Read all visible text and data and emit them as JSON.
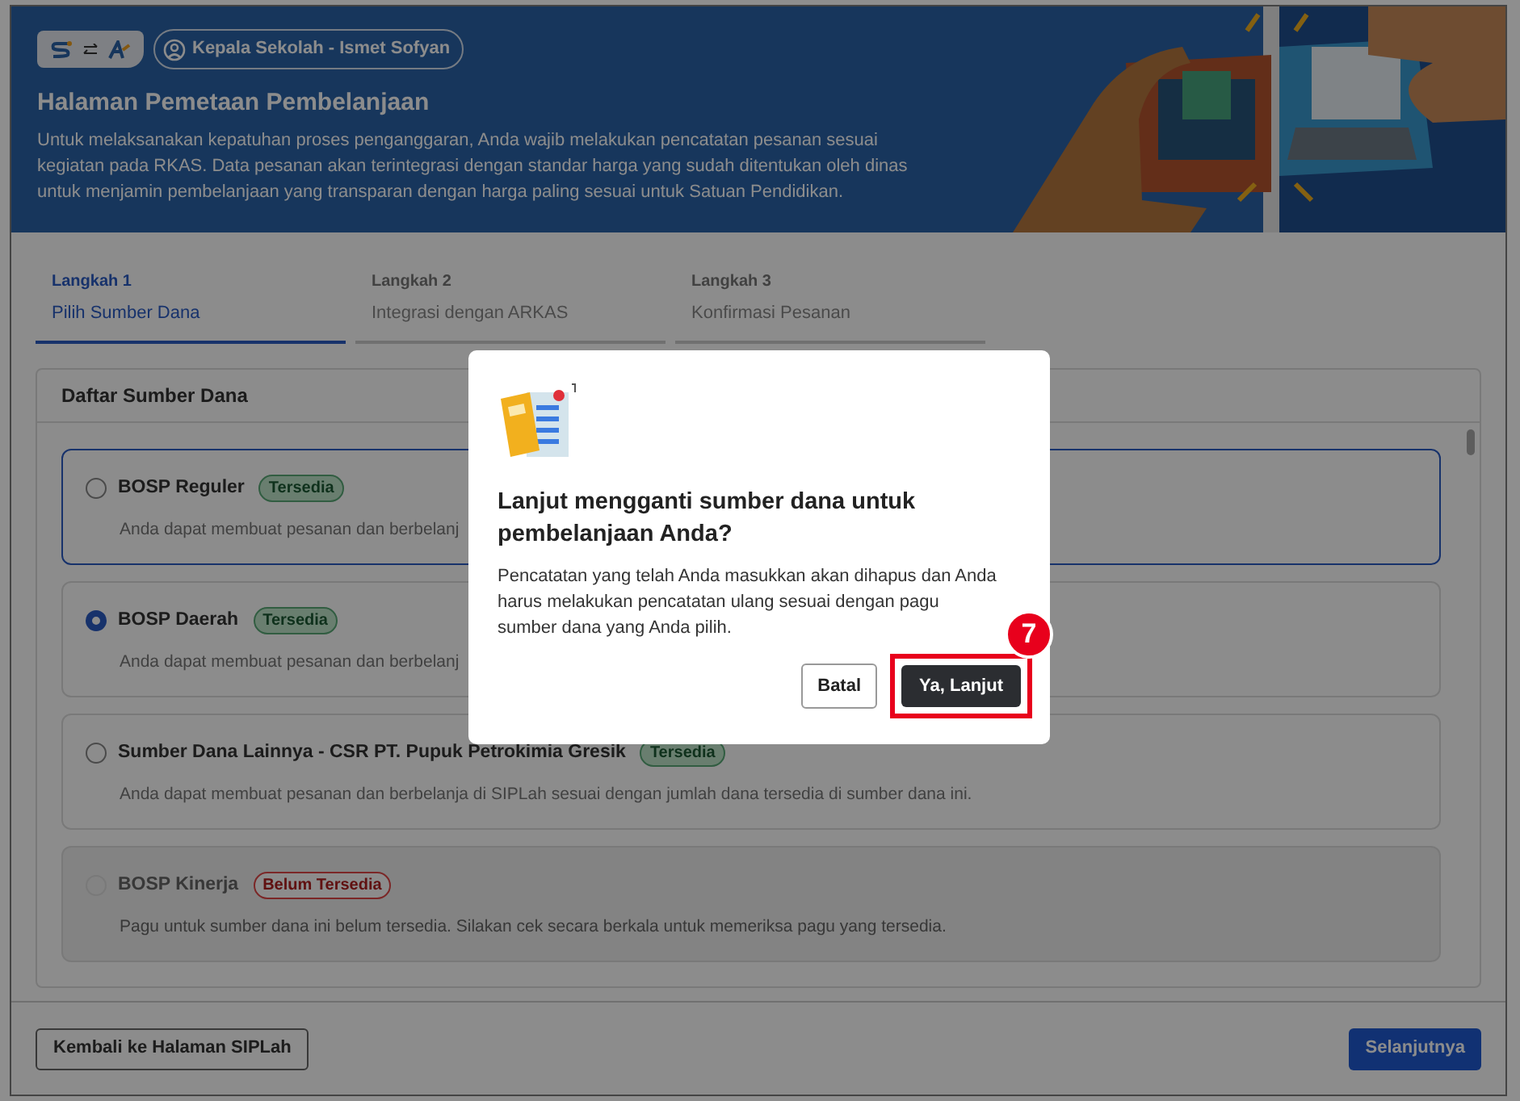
{
  "header": {
    "role_chip": "Kepala Sekolah - Ismet Sofyan",
    "title": "Halaman Pemetaan Pembelanjaan",
    "description": "Untuk melaksanakan kepatuhan proses penganggaran, Anda wajib melakukan pencatatan pesanan sesuai kegiatan pada RKAS. Data pesanan akan terintegrasi dengan standar harga yang sudah ditentukan oleh dinas untuk menjamin pembelanjaan yang transparan dengan harga paling sesuai untuk Satuan Pendidikan."
  },
  "steps": [
    {
      "step": "Langkah 1",
      "label": "Pilih Sumber Dana",
      "selected": true
    },
    {
      "step": "Langkah 2",
      "label": "Integrasi dengan ARKAS",
      "selected": false
    },
    {
      "step": "Langkah 3",
      "label": "Konfirmasi Pesanan",
      "selected": false
    }
  ],
  "fund_list": {
    "title": "Daftar Sumber Dana",
    "options": [
      {
        "name": "BOSP Reguler",
        "badge": "Tersedia",
        "kind": "available",
        "description": "Anda dapat membuat pesanan dan berbelanj",
        "selected": false,
        "focused": true,
        "disabled": false
      },
      {
        "name": "BOSP Daerah",
        "badge": "Tersedia",
        "kind": "available",
        "description": "Anda dapat membuat pesanan dan berbelanj",
        "selected": true,
        "focused": false,
        "disabled": false
      },
      {
        "name": "Sumber Dana Lainnya - CSR PT. Pupuk Petrokimia Gresik",
        "badge": "Tersedia",
        "kind": "available",
        "description": "Anda dapat membuat pesanan dan berbelanja di SIPLah sesuai dengan jumlah dana tersedia di sumber dana ini.",
        "selected": false,
        "focused": false,
        "disabled": false
      },
      {
        "name": "BOSP Kinerja",
        "badge": "Belum Tersedia",
        "kind": "unavailable",
        "description": "Pagu untuk sumber dana ini belum tersedia. Silakan cek secara berkala untuk memeriksa pagu yang tersedia.",
        "selected": false,
        "focused": false,
        "disabled": true
      }
    ]
  },
  "footer": {
    "back_button": "Kembali ke Halaman SIPLah",
    "next_button": "Selanjutnya"
  },
  "dialog": {
    "title": "Lanjut mengganti sumber dana untuk pembelanjaan Anda?",
    "message": "Pencatatan yang telah Anda masukkan akan dihapus dan Anda harus melakukan pencatatan ulang sesuai dengan pagu sumber dana yang Anda pilih.",
    "cancel_button": "Batal",
    "confirm_button": "Ya, Lanjut",
    "callout": "7"
  }
}
